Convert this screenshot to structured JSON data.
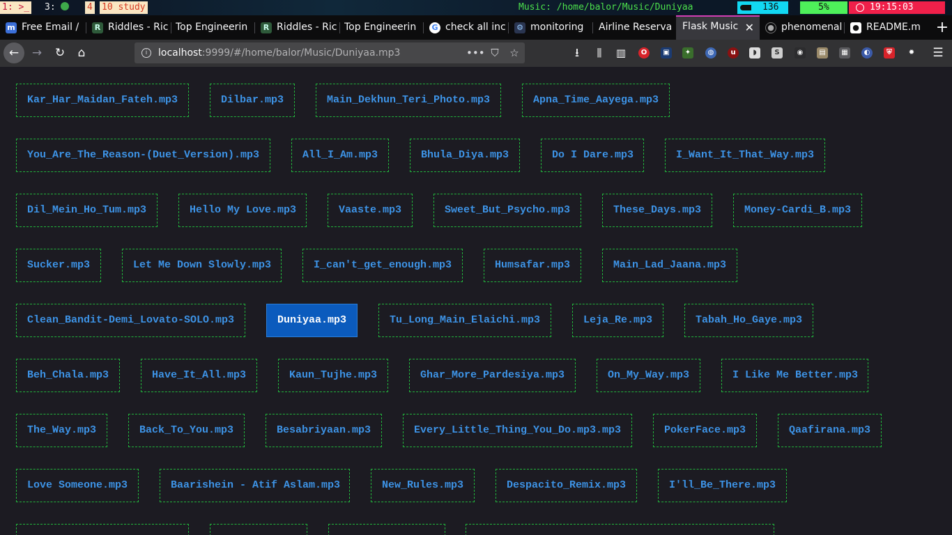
{
  "i3bar": {
    "ws1": "1: >_",
    "ws3": "3:",
    "ws4": "4",
    "ws10": "10 study",
    "music_status": "Music: /home/balor/Music/Duniyaa",
    "volume": "136",
    "battery": "5%",
    "clock": "19:15:03"
  },
  "tabs": [
    {
      "title": "Free Email /",
      "icon": "mail-icon"
    },
    {
      "title": "Riddles - Ric",
      "icon": "r-logo-icon"
    },
    {
      "title": "Top Engineerin",
      "icon": "none"
    },
    {
      "title": "Riddles - Ric",
      "icon": "r-logo-icon"
    },
    {
      "title": "Top Engineerin",
      "icon": "none"
    },
    {
      "title": "check all inc",
      "icon": "google-icon"
    },
    {
      "title": "monitoring",
      "icon": "settings-icon"
    },
    {
      "title": "Airline Reserva",
      "icon": "none"
    },
    {
      "title": "Flask Music",
      "icon": "none",
      "active": true
    },
    {
      "title": "phenomenal",
      "icon": "github-icon"
    },
    {
      "title": "README.m",
      "icon": "github-icon"
    }
  ],
  "navbar": {
    "url_host": "localhost",
    "url_rest": ":9999/#/home/balor/Music/Duniyaa.mp3"
  },
  "songs": [
    "Kar_Har_Maidan_Fateh.mp3",
    "Dilbar.mp3",
    "Main_Dekhun_Teri_Photo.mp3",
    "Apna_Time_Aayega.mp3",
    "You_Are_The_Reason-(Duet_Version).mp3",
    "All_I_Am.mp3",
    "Bhula_Diya.mp3",
    "Do I Dare.mp3",
    "I_Want_It_That_Way.mp3",
    "Dil_Mein_Ho_Tum.mp3",
    "Hello My Love.mp3",
    "Vaaste.mp3",
    "Sweet_But_Psycho.mp3",
    "These_Days.mp3",
    "Money-Cardi_B.mp3",
    "Sucker.mp3",
    "Let Me Down Slowly.mp3",
    "I_can't_get_enough.mp3",
    "Humsafar.mp3",
    "Main_Lad_Jaana.mp3",
    "Clean_Bandit-Demi_Lovato-SOLO.mp3",
    "Duniyaa.mp3",
    "Tu_Long_Main_Elaichi.mp3",
    "Leja_Re.mp3",
    "Tabah_Ho_Gaye.mp3",
    "Beh_Chala.mp3",
    "Have_It_All.mp3",
    "Kaun_Tujhe.mp3",
    "Ghar_More_Pardesiya.mp3",
    "On_My_Way.mp3",
    "I Like Me Better.mp3",
    "The_Way.mp3",
    "Back_To_You.mp3",
    "Besabriyaan.mp3",
    "Every_Little_Thing_You_Do.mp3.mp3",
    "PokerFace.mp3",
    "Qaafirana.mp3",
    "Love Someone.mp3",
    "Baarishein - Atif Aslam.mp3",
    "New_Rules.mp3",
    "Despacito_Remix.mp3",
    "I'll_Be_There.mp3",
    "",
    "",
    "",
    ""
  ],
  "current_song_index": 21,
  "colors": {
    "song_text": "#3d93e6",
    "song_border": "#22b53c",
    "active_bg": "#0b5bbd",
    "page_bg": "#1c1b22"
  }
}
